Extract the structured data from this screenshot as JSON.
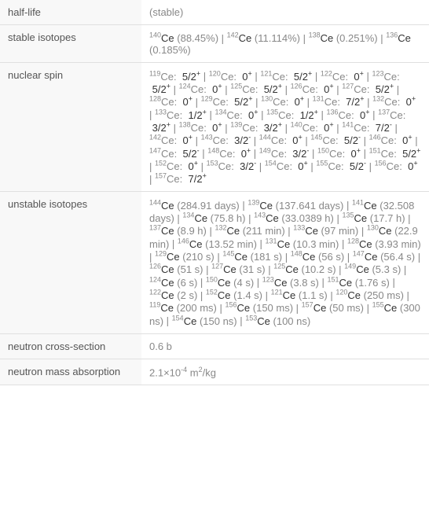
{
  "chart_data": {
    "type": "table",
    "title": "Cerium Isotope Properties",
    "rows": [
      {
        "property": "half-life",
        "value": "(stable)"
      },
      {
        "property": "stable isotopes",
        "value": "140Ce (88.45%) | 142Ce (11.114%) | 138Ce (0.251%) | 136Ce (0.185%)"
      },
      {
        "property": "nuclear spin",
        "value": "119Ce: 5/2+ | 120Ce: 0+ | 121Ce: 5/2+ | 122Ce: 0+ | 123Ce: 5/2+ | 124Ce: 0+ | 125Ce: 5/2+ | 126Ce: 0+ | 127Ce: 5/2+ | 128Ce: 0+ | 129Ce: 5/2+ | 130Ce: 0+ | 131Ce: 7/2+ | 132Ce: 0+ | 133Ce: 1/2+ | 134Ce: 0+ | 135Ce: 1/2+ | 136Ce: 0+ | 137Ce: 3/2+ | 138Ce: 0+ | 139Ce: 3/2+ | 140Ce: 0+ | 141Ce: 7/2- | 142Ce: 0+ | 143Ce: 3/2- | 144Ce: 0+ | 145Ce: 5/2- | 146Ce: 0+ | 147Ce: 5/2- | 148Ce: 0+ | 149Ce: 3/2- | 150Ce: 0+ | 151Ce: 5/2+ | 152Ce: 0+ | 153Ce: 3/2- | 154Ce: 0+ | 155Ce: 5/2- | 156Ce: 0+ | 157Ce: 7/2+"
      },
      {
        "property": "unstable isotopes",
        "value": "144Ce (284.91 days) | 139Ce (137.641 days) | 141Ce (32.508 days) | 134Ce (75.8 h) | 143Ce (33.0389 h) | 135Ce (17.7 h) | 137Ce (8.9 h) | 132Ce (211 min) | 133Ce (97 min) | 130Ce (22.9 min) | 146Ce (13.52 min) | 131Ce (10.3 min) | 128Ce (3.93 min) | 129Ce (210 s) | 145Ce (181 s) | 148Ce (56 s) | 147Ce (56.4 s) | 126Ce (51 s) | 127Ce (31 s) | 125Ce (10.2 s) | 149Ce (5.3 s) | 124Ce (6 s) | 150Ce (4 s) | 123Ce (3.8 s) | 151Ce (1.76 s) | 122Ce (2 s) | 152Ce (1.4 s) | 121Ce (1.1 s) | 120Ce (250 ms) | 119Ce (200 ms) | 156Ce (150 ms) | 157Ce (50 ms) | 155Ce (300 ns) | 154Ce (150 ns) | 153Ce (100 ns)"
      },
      {
        "property": "neutron cross-section",
        "value": "0.6 b"
      },
      {
        "property": "neutron mass absorption",
        "value": "2.1×10^-4 m^2/kg"
      }
    ]
  },
  "labels": {
    "half_life": "half-life",
    "stable_isotopes": "stable isotopes",
    "nuclear_spin": "nuclear spin",
    "unstable_isotopes": "unstable isotopes",
    "neutron_cross_section": "neutron cross-section",
    "neutron_mass_absorption": "neutron mass absorption"
  },
  "values": {
    "half_life": "(stable)",
    "neutron_cross_section": "0.6 b"
  },
  "stable": [
    {
      "mass": "140",
      "sym": "Ce",
      "pct": "(88.45%)"
    },
    {
      "mass": "142",
      "sym": "Ce",
      "pct": "(11.114%)"
    },
    {
      "mass": "138",
      "sym": "Ce",
      "pct": "(0.251%)"
    },
    {
      "mass": "136",
      "sym": "Ce",
      "pct": "(0.185%)"
    }
  ],
  "spins": [
    {
      "mass": "119",
      "sym": "Ce:",
      "spin": "5/2",
      "sign": "+"
    },
    {
      "mass": "120",
      "sym": "Ce:",
      "spin": "0",
      "sign": "+"
    },
    {
      "mass": "121",
      "sym": "Ce:",
      "spin": "5/2",
      "sign": "+"
    },
    {
      "mass": "122",
      "sym": "Ce:",
      "spin": "0",
      "sign": "+"
    },
    {
      "mass": "123",
      "sym": "Ce:",
      "spin": "5/2",
      "sign": "+"
    },
    {
      "mass": "124",
      "sym": "Ce:",
      "spin": "0",
      "sign": "+"
    },
    {
      "mass": "125",
      "sym": "Ce:",
      "spin": "5/2",
      "sign": "+"
    },
    {
      "mass": "126",
      "sym": "Ce:",
      "spin": "0",
      "sign": "+"
    },
    {
      "mass": "127",
      "sym": "Ce:",
      "spin": "5/2",
      "sign": "+"
    },
    {
      "mass": "128",
      "sym": "Ce:",
      "spin": "0",
      "sign": "+"
    },
    {
      "mass": "129",
      "sym": "Ce:",
      "spin": "5/2",
      "sign": "+"
    },
    {
      "mass": "130",
      "sym": "Ce:",
      "spin": "0",
      "sign": "+"
    },
    {
      "mass": "131",
      "sym": "Ce:",
      "spin": "7/2",
      "sign": "+"
    },
    {
      "mass": "132",
      "sym": "Ce:",
      "spin": "0",
      "sign": "+"
    },
    {
      "mass": "133",
      "sym": "Ce:",
      "spin": "1/2",
      "sign": "+"
    },
    {
      "mass": "134",
      "sym": "Ce:",
      "spin": "0",
      "sign": "+"
    },
    {
      "mass": "135",
      "sym": "Ce:",
      "spin": "1/2",
      "sign": "+"
    },
    {
      "mass": "136",
      "sym": "Ce:",
      "spin": "0",
      "sign": "+"
    },
    {
      "mass": "137",
      "sym": "Ce:",
      "spin": "3/2",
      "sign": "+"
    },
    {
      "mass": "138",
      "sym": "Ce:",
      "spin": "0",
      "sign": "+"
    },
    {
      "mass": "139",
      "sym": "Ce:",
      "spin": "3/2",
      "sign": "+"
    },
    {
      "mass": "140",
      "sym": "Ce:",
      "spin": "0",
      "sign": "+"
    },
    {
      "mass": "141",
      "sym": "Ce:",
      "spin": "7/2",
      "sign": "-"
    },
    {
      "mass": "142",
      "sym": "Ce:",
      "spin": "0",
      "sign": "+"
    },
    {
      "mass": "143",
      "sym": "Ce:",
      "spin": "3/2",
      "sign": "-"
    },
    {
      "mass": "144",
      "sym": "Ce:",
      "spin": "0",
      "sign": "+"
    },
    {
      "mass": "145",
      "sym": "Ce:",
      "spin": "5/2",
      "sign": "-"
    },
    {
      "mass": "146",
      "sym": "Ce:",
      "spin": "0",
      "sign": "+"
    },
    {
      "mass": "147",
      "sym": "Ce:",
      "spin": "5/2",
      "sign": "-"
    },
    {
      "mass": "148",
      "sym": "Ce:",
      "spin": "0",
      "sign": "+"
    },
    {
      "mass": "149",
      "sym": "Ce:",
      "spin": "3/2",
      "sign": "-"
    },
    {
      "mass": "150",
      "sym": "Ce:",
      "spin": "0",
      "sign": "+"
    },
    {
      "mass": "151",
      "sym": "Ce:",
      "spin": "5/2",
      "sign": "+"
    },
    {
      "mass": "152",
      "sym": "Ce:",
      "spin": "0",
      "sign": "+"
    },
    {
      "mass": "153",
      "sym": "Ce:",
      "spin": "3/2",
      "sign": "-"
    },
    {
      "mass": "154",
      "sym": "Ce:",
      "spin": "0",
      "sign": "+"
    },
    {
      "mass": "155",
      "sym": "Ce:",
      "spin": "5/2",
      "sign": "-"
    },
    {
      "mass": "156",
      "sym": "Ce:",
      "spin": "0",
      "sign": "+"
    },
    {
      "mass": "157",
      "sym": "Ce:",
      "spin": "7/2",
      "sign": "+"
    }
  ],
  "unstable": [
    {
      "mass": "144",
      "sym": "Ce",
      "hl": "(284.91 days)"
    },
    {
      "mass": "139",
      "sym": "Ce",
      "hl": "(137.641 days)"
    },
    {
      "mass": "141",
      "sym": "Ce",
      "hl": "(32.508 days)"
    },
    {
      "mass": "134",
      "sym": "Ce",
      "hl": "(75.8 h)"
    },
    {
      "mass": "143",
      "sym": "Ce",
      "hl": "(33.0389 h)"
    },
    {
      "mass": "135",
      "sym": "Ce",
      "hl": "(17.7 h)"
    },
    {
      "mass": "137",
      "sym": "Ce",
      "hl": "(8.9 h)"
    },
    {
      "mass": "132",
      "sym": "Ce",
      "hl": "(211 min)"
    },
    {
      "mass": "133",
      "sym": "Ce",
      "hl": "(97 min)"
    },
    {
      "mass": "130",
      "sym": "Ce",
      "hl": "(22.9 min)"
    },
    {
      "mass": "146",
      "sym": "Ce",
      "hl": "(13.52 min)"
    },
    {
      "mass": "131",
      "sym": "Ce",
      "hl": "(10.3 min)"
    },
    {
      "mass": "128",
      "sym": "Ce",
      "hl": "(3.93 min)"
    },
    {
      "mass": "129",
      "sym": "Ce",
      "hl": "(210 s)"
    },
    {
      "mass": "145",
      "sym": "Ce",
      "hl": "(181 s)"
    },
    {
      "mass": "148",
      "sym": "Ce",
      "hl": "(56 s)"
    },
    {
      "mass": "147",
      "sym": "Ce",
      "hl": "(56.4 s)"
    },
    {
      "mass": "126",
      "sym": "Ce",
      "hl": "(51 s)"
    },
    {
      "mass": "127",
      "sym": "Ce",
      "hl": "(31 s)"
    },
    {
      "mass": "125",
      "sym": "Ce",
      "hl": "(10.2 s)"
    },
    {
      "mass": "149",
      "sym": "Ce",
      "hl": "(5.3 s)"
    },
    {
      "mass": "124",
      "sym": "Ce",
      "hl": "(6 s)"
    },
    {
      "mass": "150",
      "sym": "Ce",
      "hl": "(4 s)"
    },
    {
      "mass": "123",
      "sym": "Ce",
      "hl": "(3.8 s)"
    },
    {
      "mass": "151",
      "sym": "Ce",
      "hl": "(1.76 s)"
    },
    {
      "mass": "122",
      "sym": "Ce",
      "hl": "(2 s)"
    },
    {
      "mass": "152",
      "sym": "Ce",
      "hl": "(1.4 s)"
    },
    {
      "mass": "121",
      "sym": "Ce",
      "hl": "(1.1 s)"
    },
    {
      "mass": "120",
      "sym": "Ce",
      "hl": "(250 ms)"
    },
    {
      "mass": "119",
      "sym": "Ce",
      "hl": "(200 ms)"
    },
    {
      "mass": "156",
      "sym": "Ce",
      "hl": "(150 ms)"
    },
    {
      "mass": "157",
      "sym": "Ce",
      "hl": "(50 ms)"
    },
    {
      "mass": "155",
      "sym": "Ce",
      "hl": "(300 ns)"
    },
    {
      "mass": "154",
      "sym": "Ce",
      "hl": "(150 ns)"
    },
    {
      "mass": "153",
      "sym": "Ce",
      "hl": "(100 ns)"
    }
  ],
  "nma": {
    "coef": "2.1×10",
    "exp": "-4",
    "unit": " m",
    "unitexp": "2",
    "rest": "/kg"
  },
  "sep": " | "
}
